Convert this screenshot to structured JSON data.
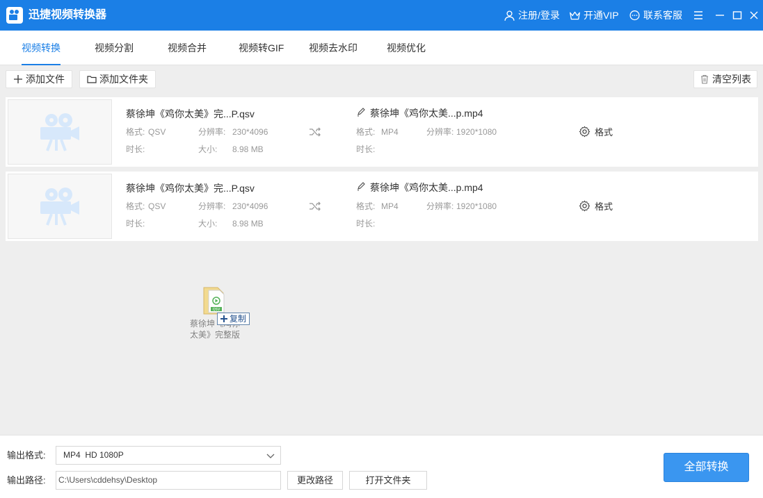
{
  "app": {
    "title": "迅捷视频转换器",
    "login": "注册/登录",
    "vip": "开通VIP",
    "service": "联系客服"
  },
  "tabs": [
    "视频转换",
    "视频分割",
    "视频合并",
    "视频转GIF",
    "视频去水印",
    "视频优化"
  ],
  "toolbar": {
    "add_file": "添加文件",
    "add_folder": "添加文件夹",
    "clear_list": "清空列表"
  },
  "labels": {
    "format": "格式:",
    "resolution": "分辨率:",
    "duration": "时长:",
    "size": "大小:",
    "settings": "格式"
  },
  "files": [
    {
      "src_name": "蔡徐坤《鸡你太美》完...P.qsv",
      "src_format": "QSV",
      "src_resolution": "230*4096",
      "src_duration": "",
      "src_size": "8.98 MB",
      "out_name": "蔡徐坤《鸡你太美...p.mp4",
      "out_format": "MP4",
      "out_resolution": "1920*1080",
      "out_duration": ""
    },
    {
      "src_name": "蔡徐坤《鸡你太美》完...P.qsv",
      "src_format": "QSV",
      "src_resolution": "230*4096",
      "src_duration": "",
      "src_size": "8.98 MB",
      "out_name": "蔡徐坤《鸡你太美...p.mp4",
      "out_format": "MP4",
      "out_resolution": "1920*1080",
      "out_duration": ""
    }
  ],
  "drag": {
    "copy_label": "复制",
    "file_label_line1": "蔡徐坤《鸡你",
    "file_label_line2": "太美》完整版",
    "badge": "QSV"
  },
  "bottom": {
    "output_format_label": "输出格式:",
    "output_format_value": "MP4  HD 1080P",
    "output_path_label": "输出路径:",
    "output_path_value": "C:\\Users\\cddehsy\\Desktop",
    "change_path": "更改路径",
    "open_folder": "打开文件夹",
    "convert_all": "全部转换"
  },
  "colors": {
    "accent": "#1b7fe6",
    "convert_button": "#3a96f0"
  }
}
